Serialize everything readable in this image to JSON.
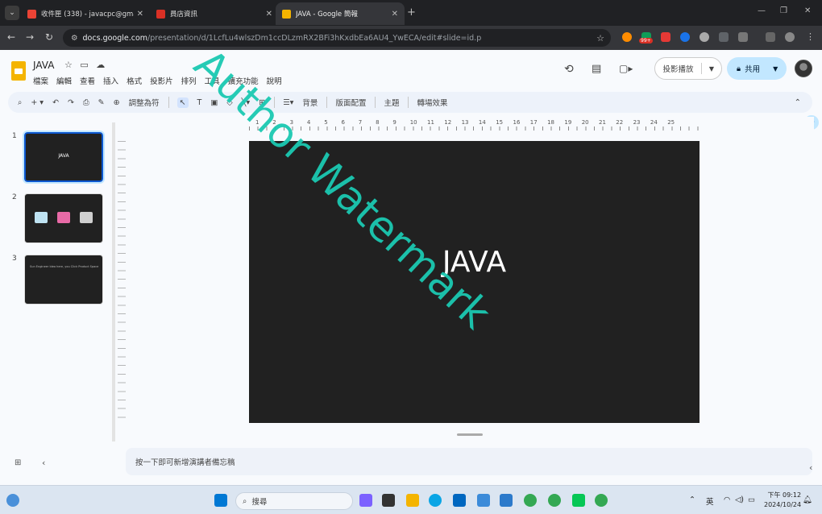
{
  "browser": {
    "tabs": [
      {
        "title": "收件匣 (338) - javacpc@gmai",
        "close": "✕"
      },
      {
        "title": "員店資訊",
        "close": "✕"
      },
      {
        "title": "JAVA - Google 簡報",
        "close": "✕"
      }
    ],
    "new_tab": "+",
    "url_host": "docs.google.com",
    "url_path": "/presentation/d/1LcfLu4wlszDm1ccDLzmRX2BFi3hKxdbEa6AU4_YwECA/edit#slide=id.p",
    "badge_count": "99+"
  },
  "docs": {
    "title": "JAVA",
    "menu": [
      "檔案",
      "編輯",
      "查看",
      "插入",
      "格式",
      "投影片",
      "排列",
      "工具",
      "擴充功能",
      "說明"
    ],
    "present_label": "投影播放",
    "share_label": "共用",
    "toolbar": {
      "zoom_label": "調整為符",
      "background": "背景",
      "layout": "版面配置",
      "theme": "主題",
      "transition": "轉場效果"
    },
    "ruler_labels": [
      "1",
      "2",
      "3",
      "4",
      "5",
      "6",
      "7",
      "8",
      "9",
      "10",
      "11",
      "12",
      "13",
      "14",
      "15",
      "16",
      "17",
      "18",
      "19",
      "20",
      "21",
      "22",
      "23",
      "24",
      "25"
    ],
    "slides": [
      {
        "number": "1",
        "title": "JAVA"
      },
      {
        "number": "2"
      },
      {
        "number": "3",
        "text": "Sun Engineer Idea here, you Click Product Space"
      }
    ],
    "canvas_title": "JAVA",
    "notes_placeholder": "按一下即可新增演講者備忘稿"
  },
  "watermark": "Author Watermark",
  "taskbar": {
    "search_placeholder": "搜尋",
    "ime": "英",
    "time": "下午 09:12",
    "date": "2024/10/24"
  },
  "colors": {
    "accent": "#0b57d0",
    "share": "#c2e7ff",
    "slide_bg": "#212121",
    "watermark": "#1bc9b2"
  }
}
